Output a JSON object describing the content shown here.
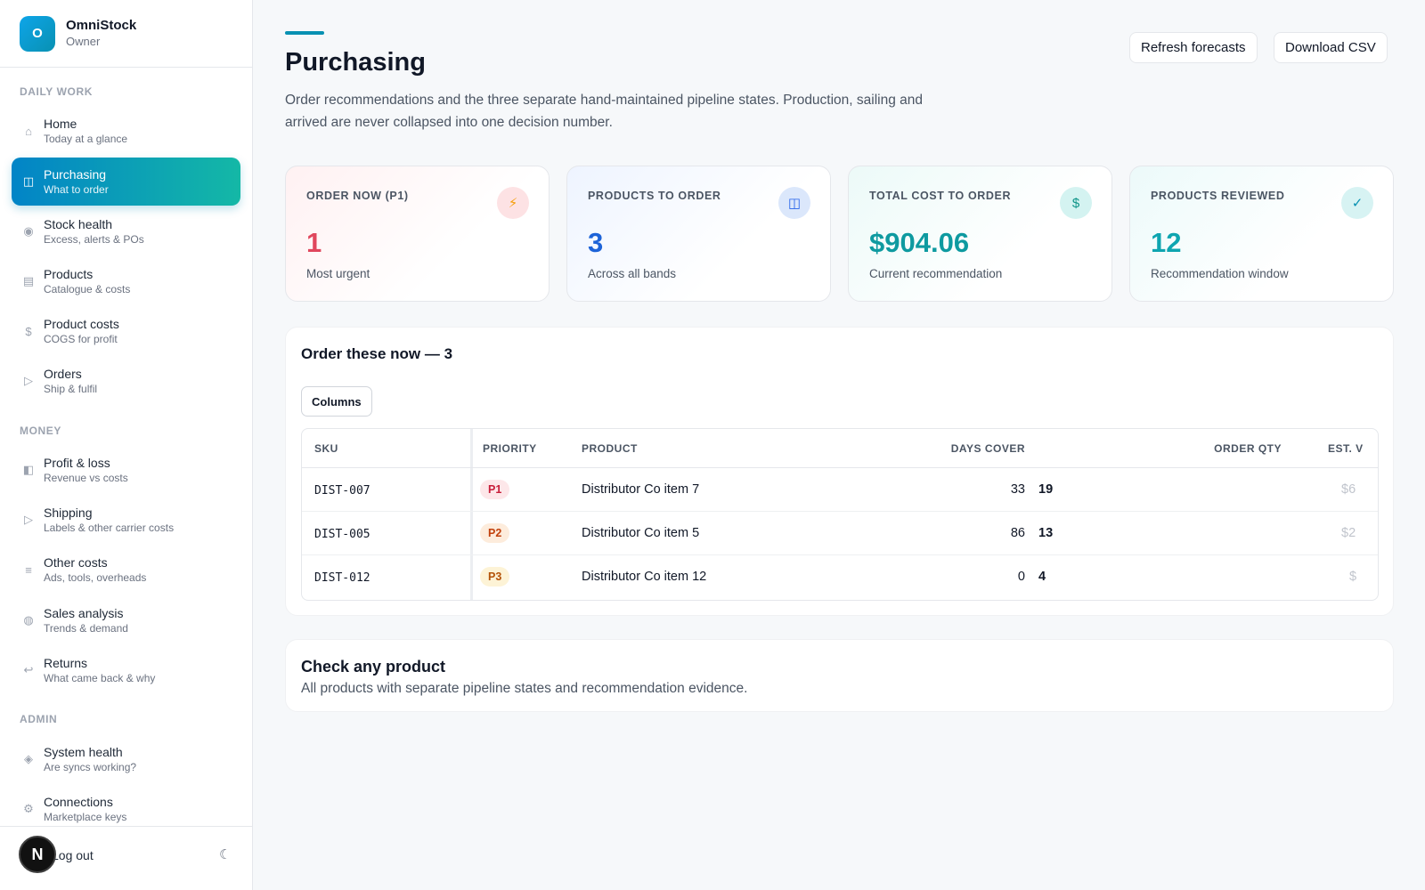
{
  "brand": {
    "logo_letter": "O",
    "name": "OmniStock",
    "role": "Owner"
  },
  "sidebar": {
    "sections": [
      "DAILY WORK",
      "MONEY",
      "ADMIN"
    ],
    "items": [
      {
        "label": "Home",
        "sub": "Today at a glance",
        "icon": "home-icon",
        "glyph": "⌂"
      },
      {
        "label": "Purchasing",
        "sub": "What to order",
        "icon": "purchasing-icon",
        "glyph": "◫",
        "active": true
      },
      {
        "label": "Stock health",
        "sub": "Excess, alerts & POs",
        "icon": "stock-health-icon",
        "glyph": "◉"
      },
      {
        "label": "Products",
        "sub": "Catalogue & costs",
        "icon": "products-icon",
        "glyph": "▤"
      },
      {
        "label": "Product costs",
        "sub": "COGS for profit",
        "icon": "dollar-icon",
        "glyph": "$"
      },
      {
        "label": "Orders",
        "sub": "Ship & fulfil",
        "icon": "play-icon",
        "glyph": "▷"
      },
      {
        "label": "Profit & loss",
        "sub": "Revenue vs costs",
        "icon": "profit-icon",
        "glyph": "◧"
      },
      {
        "label": "Shipping",
        "sub": "Labels & other carrier costs",
        "icon": "shipping-icon",
        "glyph": "▷"
      },
      {
        "label": "Other costs",
        "sub": "Ads, tools, overheads",
        "icon": "list-icon",
        "glyph": "≡"
      },
      {
        "label": "Sales analysis",
        "sub": "Trends & demand",
        "icon": "analysis-icon",
        "glyph": "◍"
      },
      {
        "label": "Returns",
        "sub": "What came back & why",
        "icon": "return-icon",
        "glyph": "↩"
      },
      {
        "label": "System health",
        "sub": "Are syncs working?",
        "icon": "diamond-icon",
        "glyph": "◈"
      },
      {
        "label": "Connections",
        "sub": "Marketplace keys",
        "icon": "gear-icon",
        "glyph": "⚙"
      }
    ],
    "footer": {
      "logout": "Log out",
      "next_badge": "N",
      "theme_icon": "☾"
    }
  },
  "header": {
    "title": "Purchasing",
    "description": "Order recommendations and the three separate hand‑maintained pipeline states. Production, sailing and arrived are never collapsed into one decision number.",
    "refresh_label": "Refresh forecasts",
    "download_label": "Download CSV"
  },
  "cards": [
    {
      "label": "ORDER NOW (P1)",
      "value": "1",
      "hint": "Most urgent",
      "icon": "lightning-icon",
      "glyph": "⚡",
      "value_color": "#e0475d",
      "icon_bg": "#fde2e4",
      "icon_color": "#f59e0b",
      "bg": "linear-gradient(135deg,#fff1f2 0%,#ffffff 65%)"
    },
    {
      "label": "PRODUCTS TO ORDER",
      "value": "3",
      "hint": "Across all bands",
      "icon": "box-icon",
      "glyph": "◫",
      "value_color": "#1d63d8",
      "icon_bg": "#dbe7fb",
      "icon_color": "#2563eb",
      "bg": "linear-gradient(135deg,#eef4ff 0%,#ffffff 65%)"
    },
    {
      "label": "TOTAL COST TO ORDER",
      "value": "$904.06",
      "hint": "Current recommendation",
      "icon": "dollar-circle-icon",
      "glyph": "$",
      "value_color": "#0e9aa0",
      "icon_bg": "#d4f3f1",
      "icon_color": "#0d9488",
      "bg": "linear-gradient(135deg,#ecfaf8 0%,#ffffff 65%)"
    },
    {
      "label": "PRODUCTS REVIEWED",
      "value": "12",
      "hint": "Recommendation window",
      "icon": "check-icon",
      "glyph": "✓",
      "value_color": "#0ea5b0",
      "icon_bg": "#d7f3f3",
      "icon_color": "#0891b2",
      "bg": "linear-gradient(135deg,#ecfafa 0%,#ffffff 65%)"
    }
  ],
  "order_panel": {
    "title": "Order these now — 3",
    "columns_button": "Columns",
    "headers": {
      "sku": "SKU",
      "priority": "PRIORITY",
      "product": "PRODUCT",
      "days_cover": "DAYS COVER",
      "order_qty": "ORDER QTY",
      "est_value": "EST. V"
    },
    "rows": [
      {
        "sku": "DIST-007",
        "priority": "P1",
        "product": "Distributor Co item 7",
        "days_cover": "33",
        "qty": "19",
        "est": "$6",
        "pill_bg": "#fde7e9",
        "pill_color": "#c81e3a"
      },
      {
        "sku": "DIST-005",
        "priority": "P2",
        "product": "Distributor Co item 5",
        "days_cover": "86",
        "qty": "13",
        "est": "$2",
        "pill_bg": "#fdecdc",
        "pill_color": "#c2410c"
      },
      {
        "sku": "DIST-012",
        "priority": "P3",
        "product": "Distributor Co item 12",
        "days_cover": "0",
        "qty": "4",
        "est": "$",
        "pill_bg": "#fdf3d6",
        "pill_color": "#b45309"
      }
    ]
  },
  "check_panel": {
    "title": "Check any product",
    "description": "All products with separate pipeline states and recommendation evidence."
  }
}
